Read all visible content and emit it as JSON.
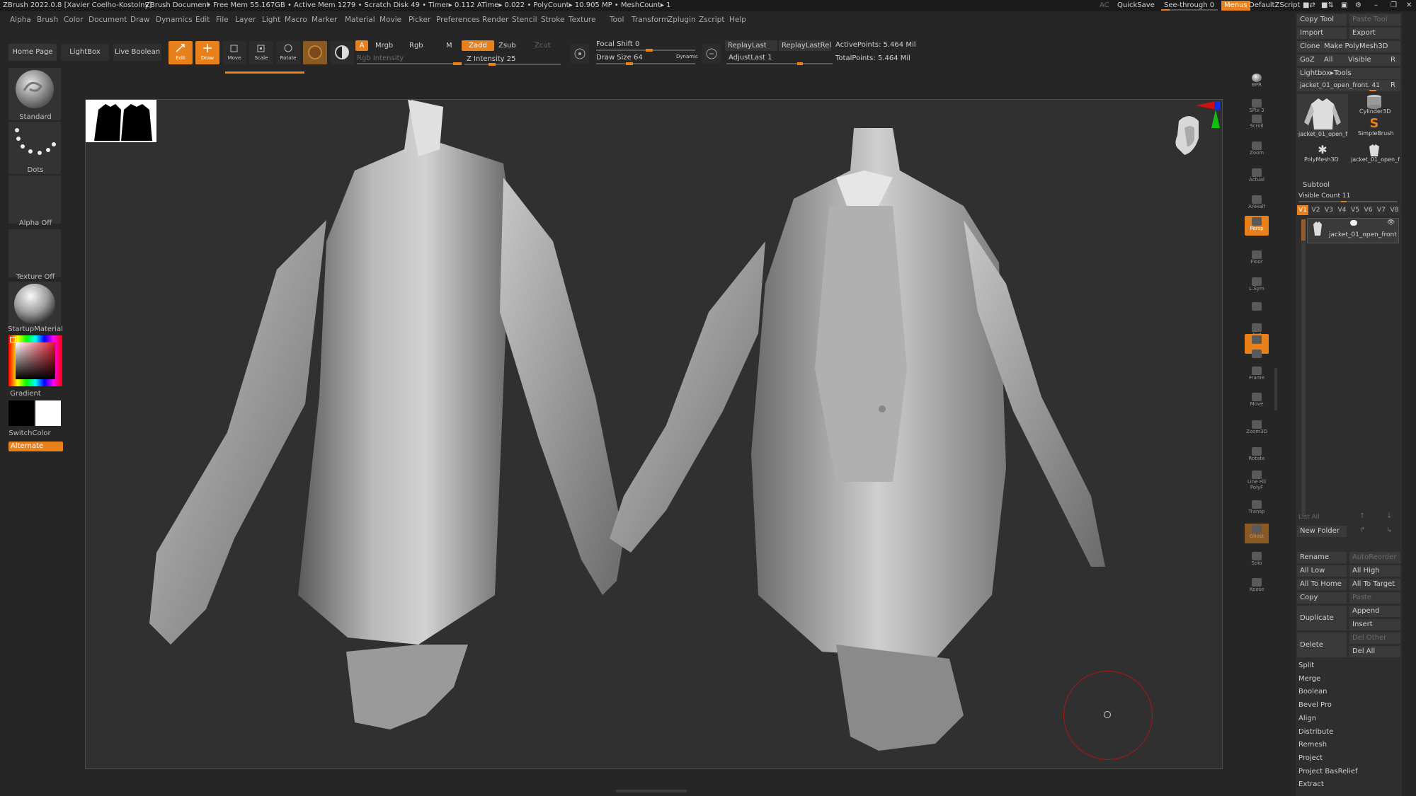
{
  "titlebar": {
    "app": "ZBrush 2022.0.8 [Xavier Coelho-Kostolny]",
    "document": "ZBrush Document",
    "stats": "• Free Mem 55.167GB • Active Mem 1279 • Scratch Disk 49 • Timer▸ 0.112 ATime▸ 0.022 • PolyCount▸ 10.905 MP • MeshCount▸ 1",
    "ac": "AC",
    "quicksave": "QuickSave",
    "see_through": "See-through  0",
    "menus": "Menus",
    "script": "DefaultZScript"
  },
  "menubar": [
    "Alpha",
    "Brush",
    "Color",
    "Document",
    "Draw",
    "Dynamics",
    "Edit",
    "File",
    "Layer",
    "Light",
    "Macro",
    "Marker",
    "Material",
    "Movie",
    "Picker",
    "Preferences",
    "Render",
    "Stencil",
    "Stroke",
    "Texture",
    "Tool",
    "Transform",
    "Zplugin",
    "Zscript",
    "Help"
  ],
  "toolbar": {
    "home_page": "Home Page",
    "lightbox": "LightBox",
    "live_boolean": "Live Boolean",
    "edit": "Edit",
    "draw": "Draw",
    "move": "Move",
    "scale": "Scale",
    "rotate": "Rotate",
    "a": "A",
    "mrgb": "Mrgb",
    "rgb": "Rgb",
    "m": "M",
    "rgb_intensity": "Rgb Intensity",
    "zadd": "Zadd",
    "zsub": "Zsub",
    "zcut": "Zcut",
    "z_intensity": "Z Intensity 25",
    "z_intensity_value": 0.25,
    "focal_shift": "Focal Shift 0",
    "focal_shift_value": 0.5,
    "draw_size": "Draw Size 64",
    "draw_size_value": 0.3,
    "dynamic": "Dynamic",
    "replay_last": "ReplayLast",
    "replay_last_rel": "ReplayLastRel",
    "adjust_last": "AdjustLast 1",
    "active_points": "ActivePoints: 5.464 Mil",
    "total_points": "TotalPoints: 5.464 Mil"
  },
  "left_panel": {
    "brush": "Standard",
    "stroke": "Dots",
    "alpha": "Alpha Off",
    "texture": "Texture Off",
    "material": "StartupMaterial",
    "gradient": "Gradient",
    "switch_color": "SwitchColor",
    "alternate": "Alternate"
  },
  "shelf": [
    "BPR",
    "SPix 3",
    "Scroll",
    "Zoom",
    "Actual",
    "AAHalf",
    "Persp",
    "Floor",
    "L.Sym",
    "",
    "Xyz",
    "",
    "",
    "Frame",
    "Move",
    "Zoom3D",
    "Rotate",
    "Line Fill PolyF",
    "Transp",
    "Ghost",
    "Solo",
    "Xpose"
  ],
  "tool_panel": {
    "copy_tool": "Copy Tool",
    "paste_tool": "Paste Tool",
    "import": "Import",
    "export": "Export",
    "clone": "Clone",
    "make_polymesh": "Make PolyMesh3D",
    "goz": "GoZ",
    "all": "All",
    "visible": "Visible",
    "r": "R",
    "lightbox_tools": "Lightbox▸Tools",
    "current_tool": "jacket_01_open_front. 41",
    "tools": [
      {
        "name": "jacket_01_open_f"
      },
      {
        "name": "Cylinder3D"
      },
      {
        "name": "SimpleBrush"
      },
      {
        "name": "PolyMesh3D"
      },
      {
        "name": "jacket_01_open_f"
      }
    ],
    "subtool": "Subtool",
    "visible_count": "Visible Count 11",
    "versions": [
      "V1",
      "V2",
      "V3",
      "V4",
      "V5",
      "V6",
      "V7",
      "V8"
    ],
    "subtool_name": "jacket_01_open_front",
    "list_all": "List All",
    "new_folder": "New Folder",
    "rename": "Rename",
    "auto_reorder": "AutoReorder",
    "all_low": "All Low",
    "all_high": "All High",
    "all_to_home": "All To Home",
    "all_to_target": "All To Target",
    "copy": "Copy",
    "paste": "Paste",
    "duplicate": "Duplicate",
    "append": "Append",
    "insert": "Insert",
    "delete": "Delete",
    "del_other": "Del Other",
    "del_all": "Del All",
    "sections": [
      "Split",
      "Merge",
      "Boolean",
      "Bevel Pro",
      "Align",
      "Distribute",
      "Remesh",
      "Project",
      "Project BasRelief",
      "Extract"
    ]
  },
  "colors": {
    "accent": "#e8801c",
    "background": "#262626",
    "canvas": "#303030",
    "brush_cursor": "#b01515"
  }
}
